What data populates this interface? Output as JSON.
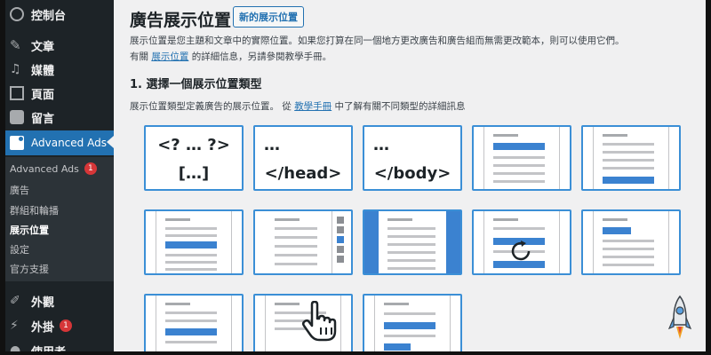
{
  "sidebar": {
    "dashboard": "控制台",
    "posts": "文章",
    "media": "媒體",
    "pages": "頁面",
    "comments": "留言",
    "advanced_ads": "Advanced Ads",
    "submenu": {
      "ads": "Advanced Ads",
      "ads_badge": "1",
      "groups_label": "廣告",
      "groups": "群組和輪播",
      "placements": "展示位置",
      "settings": "設定",
      "support": "官方支援"
    },
    "appearance": "外觀",
    "plugins": "外掛",
    "plugins_badge": "1",
    "users": "使用者"
  },
  "main": {
    "title": "廣告展示位置",
    "new_button": "新的展示位置",
    "desc1": "展示位置是您主題和文章中的實際位置。如果您打算在同一個地方更改廣告和廣告組而無需更改範本，則可以使用它們。",
    "desc2_pre": "有關",
    "desc2_link": "展示位置",
    "desc2_post": "的詳細信息，另請參閱教學手冊。",
    "section_title": "1. 選擇一個展示位置類型",
    "section_desc_pre": "展示位置類型定義廣告的展示位置。 從",
    "section_desc_link": "教學手冊",
    "section_desc_post": "中了解有關不同類型的詳細訊息"
  },
  "cards": {
    "manual_line1": "<? … ?>",
    "manual_line2": "[…]",
    "head_line1": "…",
    "head_line2": "</head>",
    "body_line1": "…",
    "body_line2": "</body>"
  },
  "colors": {
    "accent": "#2271b1",
    "card_border": "#3b8fd6",
    "ad_block": "#3b82d0",
    "sidebar_bg": "#1d2327",
    "badge": "#d63638"
  }
}
